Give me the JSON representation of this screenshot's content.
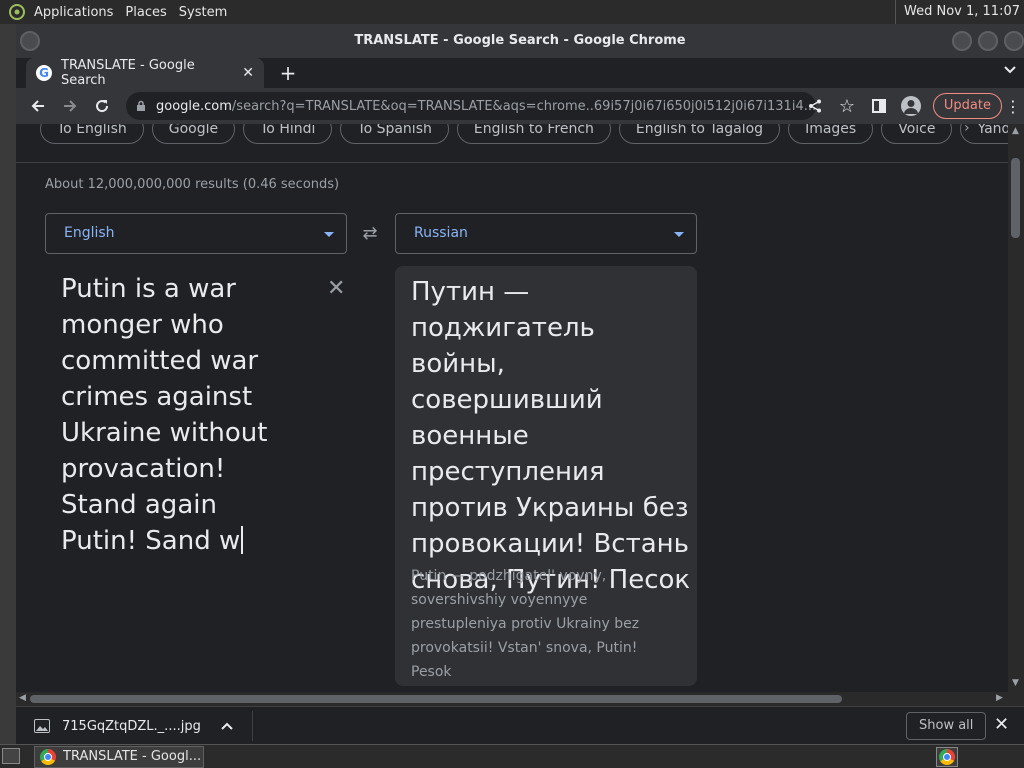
{
  "top_panel": {
    "menus": [
      "Applications",
      "Places",
      "System"
    ],
    "clock": "Wed Nov 1, 11:07"
  },
  "window": {
    "title": "TRANSLATE - Google Search - Google Chrome"
  },
  "tab": {
    "title": "TRANSLATE - Google Search",
    "favicon": "G"
  },
  "toolbar": {
    "url_host": "google.com",
    "url_rest": "/search?q=TRANSLATE&oq=TRANSLATE&aqs=chrome..69i57j0i67i650j0i512j0i67i131i4...",
    "update_label": "Update"
  },
  "chips": [
    "To English",
    "Google",
    "To Hindi",
    "To Spanish",
    "English to French",
    "English to Tagalog",
    "Images",
    "Voice",
    "Yandex"
  ],
  "results_count": "About 12,000,000,000 results (0.46 seconds)",
  "translator": {
    "source_lang": "English",
    "target_lang": "Russian",
    "source_lines": [
      "Putin is a war",
      "monger who",
      "committed war",
      "crimes against",
      "Ukraine without",
      "provacation!",
      "Stand again",
      "Putin! Sand w"
    ],
    "target_lines": [
      "Путин —",
      "поджигатель войны,",
      "совершивший",
      "военные",
      "преступления",
      "против Украины без",
      "провокации! Встань",
      "снова, Путин! Песок"
    ],
    "transliteration": "Putin — podzhigatel' voyny, sovershivshiy voyennyye prestupleniya protiv Ukrainy bez provokatsii! Vstan' snova, Putin! Pesok"
  },
  "download": {
    "filename": "715GqZtqDZL._....jpg",
    "show_all": "Show all"
  },
  "taskbar": {
    "task_title": "TRANSLATE - Googl..."
  },
  "colors": {
    "accent": "#8ab4f8",
    "update": "#f28b82",
    "page_bg": "#202124",
    "panel_bg": "#303134"
  }
}
